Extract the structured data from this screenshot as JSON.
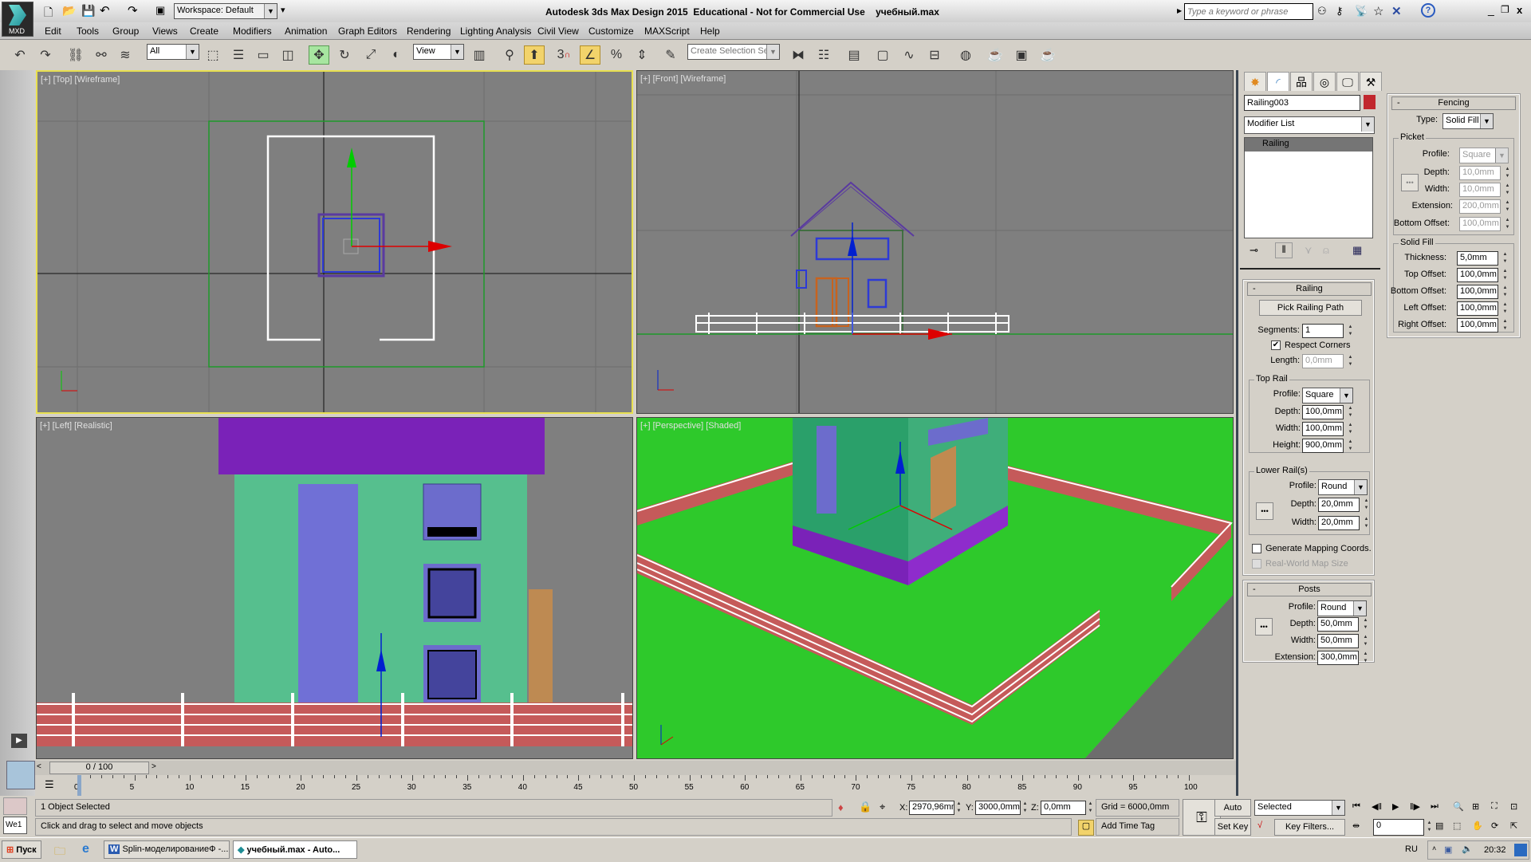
{
  "app": {
    "logo": "MXD",
    "title": "Autodesk 3ds Max Design 2015  Educational - Not for Commercial Use    учебный.max",
    "workspace": "Workspace: Default",
    "search_placeholder": "Type a keyword or phrase"
  },
  "menu": [
    "Edit",
    "Tools",
    "Group",
    "Views",
    "Create",
    "Modifiers",
    "Animation",
    "Graph Editors",
    "Rendering",
    "Lighting Analysis",
    "Civil View",
    "Customize",
    "MAXScript",
    "Help"
  ],
  "toolbar": {
    "filter": "All",
    "ref_coord": "View",
    "selection_set_placeholder": "Create Selection Se",
    "snap_label": "3"
  },
  "viewports": {
    "top": "[+] [Top] [Wireframe]",
    "front": "[+] [Front] [Wireframe]",
    "left": "[+] [Left] [Realistic]",
    "perspective": "[+] [Perspective] [Shaded]"
  },
  "command_panel": {
    "object_name": "Railing003",
    "object_color": "#c1272d",
    "modifier_list": "Modifier List",
    "stack": [
      "Railing"
    ],
    "railing": {
      "title": "Railing",
      "pick_button": "Pick Railing Path",
      "segments_label": "Segments:",
      "segments": "1",
      "respect_corners": "Respect Corners",
      "respect_corners_checked": true,
      "length_label": "Length:",
      "length": "0,0mm",
      "top_rail": {
        "title": "Top Rail",
        "profile_label": "Profile:",
        "profile": "Square",
        "depth_label": "Depth:",
        "depth": "100,0mm",
        "width_label": "Width:",
        "width": "100,0mm",
        "height_label": "Height:",
        "height": "900,0mm"
      },
      "lower_rails": {
        "title": "Lower Rail(s)",
        "profile_label": "Profile:",
        "profile": "Round",
        "depth_label": "Depth:",
        "depth": "20,0mm",
        "width_label": "Width:",
        "width": "20,0mm"
      },
      "gen_mapping": "Generate Mapping Coords.",
      "real_world": "Real-World Map Size"
    },
    "posts": {
      "title": "Posts",
      "profile_label": "Profile:",
      "profile": "Round",
      "depth_label": "Depth:",
      "depth": "50,0mm",
      "width_label": "Width:",
      "width": "50,0mm",
      "extension_label": "Extension:",
      "extension": "300,0mm"
    },
    "fencing": {
      "title": "Fencing",
      "type_label": "Type:",
      "type": "Solid Fill",
      "picket": {
        "title": "Picket",
        "profile_label": "Profile:",
        "profile": "Square",
        "depth_label": "Depth:",
        "depth": "10,0mm",
        "width_label": "Width:",
        "width": "10,0mm",
        "extension_label": "Extension:",
        "extension": "200,0mm",
        "bottom_offset_label": "Bottom Offset:",
        "bottom_offset": "100,0mm"
      },
      "solid_fill": {
        "title": "Solid Fill",
        "thickness_label": "Thickness:",
        "thickness": "5,0mm",
        "top_offset_label": "Top Offset:",
        "top_offset": "100,0mm",
        "bottom_offset_label": "Bottom Offset:",
        "bottom_offset": "100,0mm",
        "left_offset_label": "Left Offset:",
        "left_offset": "100,0mm",
        "right_offset_label": "Right Offset:",
        "right_offset": "100,0mm"
      }
    }
  },
  "timeline": {
    "frame": "0 / 100",
    "ticks": [
      0,
      5,
      10,
      15,
      20,
      25,
      30,
      35,
      40,
      45,
      50,
      55,
      60,
      65,
      70,
      75,
      80,
      85,
      90,
      95,
      100
    ]
  },
  "status": {
    "selected": "1 Object Selected",
    "prompt": "Click and drag to select and move objects",
    "script": "We1",
    "x_label": "X:",
    "x": "2970,96mm",
    "y_label": "Y:",
    "y": "3000,0mm",
    "z_label": "Z:",
    "z": "0,0mm",
    "grid": "Grid = 6000,0mm",
    "add_time_tag": "Add Time Tag",
    "auto_key": "Auto Key",
    "set_key": "Set Key",
    "key_mode": "Selected",
    "key_filters": "Key Filters...",
    "current_frame": "0"
  },
  "taskbar": {
    "start": "Пуск",
    "tasks": [
      "Splin-моделированиеФ -...",
      "учебный.max - Auto..."
    ],
    "lang": "RU",
    "clock": "20:32"
  }
}
